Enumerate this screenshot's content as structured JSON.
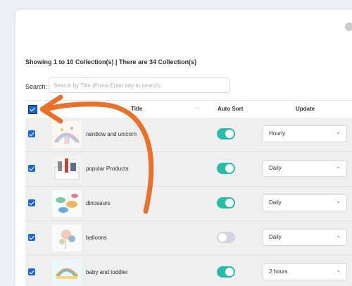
{
  "showing_text": "Showing 1 to 10 Collection(s) | There are 34 Collection(s)",
  "search": {
    "label": "Search:",
    "placeholder": "Search by Title (Press Enter key to search)",
    "value": ""
  },
  "columns": {
    "title": "Title",
    "auto_sort": "Auto Sort",
    "update": "Update"
  },
  "rows": [
    {
      "title": "rainbow and unicorn",
      "auto_sort": true,
      "update": "Hourly",
      "selected": true
    },
    {
      "title": "popular Products",
      "auto_sort": true,
      "update": "Daily",
      "selected": true
    },
    {
      "title": "dinosaurs",
      "auto_sort": true,
      "update": "Daily",
      "selected": true
    },
    {
      "title": "balloons",
      "auto_sort": false,
      "update": "Daily",
      "selected": true
    },
    {
      "title": "baby and toddler",
      "auto_sort": true,
      "update": "2 hours",
      "selected": true
    }
  ],
  "colors": {
    "accent": "#1e66d0",
    "toggle_on": "#2bbaa9",
    "toggle_off": "#d4d4e0",
    "arrow": "#e8722b"
  },
  "icons": {
    "sort": "sort-arrows-icon",
    "dropdown": "chevron-down-icon",
    "annotation": "curved-arrow-icon"
  }
}
